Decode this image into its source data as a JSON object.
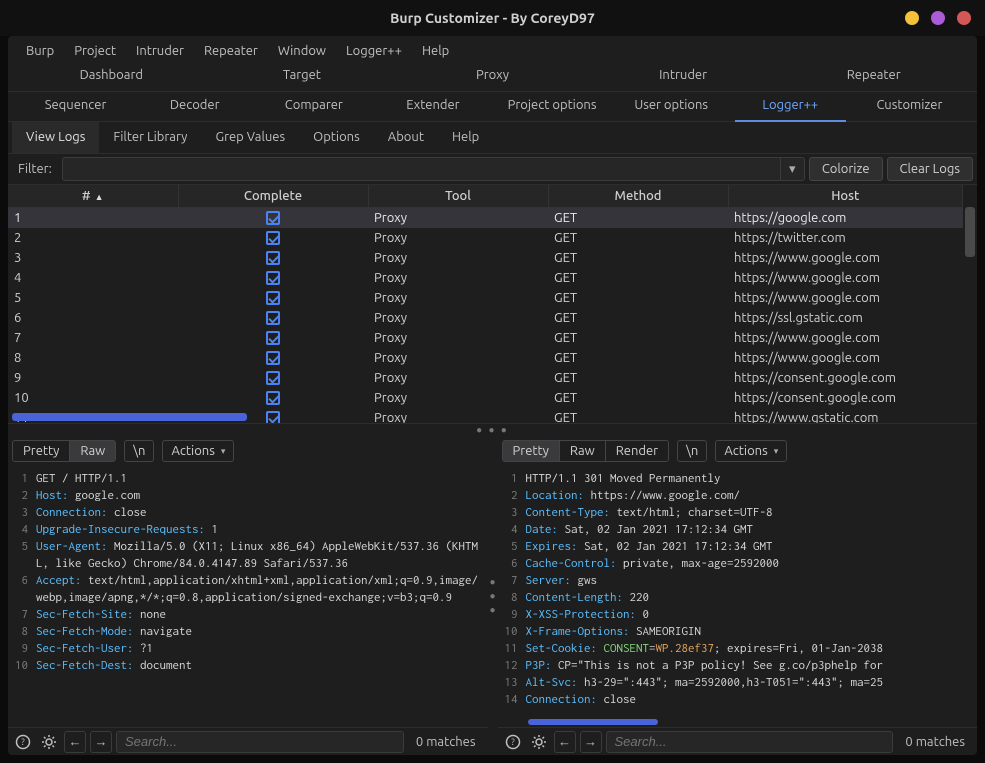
{
  "window": {
    "title": "Burp Customizer - By CoreyD97"
  },
  "menubar": [
    "Burp",
    "Project",
    "Intruder",
    "Repeater",
    "Window",
    "Logger++",
    "Help"
  ],
  "tabs_row1": [
    "Dashboard",
    "Target",
    "Proxy",
    "Intruder",
    "Repeater"
  ],
  "tabs_row2": [
    "Sequencer",
    "Decoder",
    "Comparer",
    "Extender",
    "Project options",
    "User options",
    "Logger++",
    "Customizer"
  ],
  "tabs_row2_active_index": 6,
  "subtabs": [
    "View Logs",
    "Filter Library",
    "Grep Values",
    "Options",
    "About",
    "Help"
  ],
  "subtabs_selected_index": 0,
  "filter": {
    "label": "Filter:",
    "value": "",
    "colorize_label": "Colorize",
    "clear_label": "Clear Logs"
  },
  "table": {
    "columns": [
      "#",
      "Complete",
      "Tool",
      "Method",
      "Host"
    ],
    "sort_indicator": "▲",
    "rows": [
      {
        "num": "1",
        "complete": true,
        "tool": "Proxy",
        "method": "GET",
        "host": "https://google.com",
        "selected": true
      },
      {
        "num": "2",
        "complete": true,
        "tool": "Proxy",
        "method": "GET",
        "host": "https://twitter.com"
      },
      {
        "num": "3",
        "complete": true,
        "tool": "Proxy",
        "method": "GET",
        "host": "https://www.google.com"
      },
      {
        "num": "4",
        "complete": true,
        "tool": "Proxy",
        "method": "GET",
        "host": "https://www.google.com"
      },
      {
        "num": "5",
        "complete": true,
        "tool": "Proxy",
        "method": "GET",
        "host": "https://www.google.com"
      },
      {
        "num": "6",
        "complete": true,
        "tool": "Proxy",
        "method": "GET",
        "host": "https://ssl.gstatic.com"
      },
      {
        "num": "7",
        "complete": true,
        "tool": "Proxy",
        "method": "GET",
        "host": "https://www.google.com"
      },
      {
        "num": "8",
        "complete": true,
        "tool": "Proxy",
        "method": "GET",
        "host": "https://www.google.com"
      },
      {
        "num": "9",
        "complete": true,
        "tool": "Proxy",
        "method": "GET",
        "host": "https://consent.google.com"
      },
      {
        "num": "10",
        "complete": true,
        "tool": "Proxy",
        "method": "GET",
        "host": "https://consent.google.com"
      },
      {
        "num": "11",
        "complete": true,
        "tool": "Proxy",
        "method": "GET",
        "host": "https://www.gstatic.com"
      }
    ]
  },
  "pane_toolbar": {
    "pretty": "Pretty",
    "raw": "Raw",
    "render": "Render",
    "newline": "\\n",
    "actions": "Actions"
  },
  "request_selected_seg": "Raw",
  "response_selected_seg": "Pretty",
  "request_lines": [
    {
      "n": "1",
      "html": "<span class='m'>GET / HTTP/1.1</span>"
    },
    {
      "n": "2",
      "html": "<span class='k'>Host:</span> <span class='v'>google.com</span>"
    },
    {
      "n": "3",
      "html": "<span class='k'>Connection:</span> <span class='v'>close</span>"
    },
    {
      "n": "4",
      "html": "<span class='k'>Upgrade-Insecure-Requests:</span> <span class='v'>1</span>"
    },
    {
      "n": "5",
      "html": "<span class='k'>User-Agent:</span> <span class='v'>Mozilla/5.0 (X11; Linux x86_64) AppleWebKit/537.36 (KHTML, like Gecko) Chrome/84.0.4147.89 Safari/537.36</span>"
    },
    {
      "n": "6",
      "html": "<span class='k'>Accept:</span> <span class='v'>text/html,application/xhtml+xml,application/xml;q=0.9,image/webp,image/apng,*/*;q=0.8,application/signed-exchange;v=b3;q=0.9</span>"
    },
    {
      "n": "7",
      "html": "<span class='k'>Sec-Fetch-Site:</span> <span class='v'>none</span>"
    },
    {
      "n": "8",
      "html": "<span class='k'>Sec-Fetch-Mode:</span> <span class='v'>navigate</span>"
    },
    {
      "n": "9",
      "html": "<span class='k'>Sec-Fetch-User:</span> <span class='v'>?1</span>"
    },
    {
      "n": "10",
      "html": "<span class='k'>Sec-Fetch-Dest:</span> <span class='v'>document</span>"
    }
  ],
  "response_lines": [
    {
      "n": "1",
      "html": "<span class='m'>HTTP/1.1 301 Moved Permanently</span>"
    },
    {
      "n": "2",
      "html": "<span class='k'>Location:</span> <span class='v'>https://www.google.com/</span>"
    },
    {
      "n": "3",
      "html": "<span class='k'>Content-Type:</span> <span class='v'>text/html; charset=UTF-8</span>"
    },
    {
      "n": "4",
      "html": "<span class='k'>Date:</span> <span class='v'>Sat, 02 Jan 2021 17:12:34 GMT</span>"
    },
    {
      "n": "5",
      "html": "<span class='k'>Expires:</span> <span class='v'>Sat, 02 Jan 2021 17:12:34 GMT</span>"
    },
    {
      "n": "6",
      "html": "<span class='k'>Cache-Control:</span> <span class='v'>private, max-age=2592000</span>"
    },
    {
      "n": "7",
      "html": "<span class='k'>Server:</span> <span class='v'>gws</span>"
    },
    {
      "n": "8",
      "html": "<span class='k'>Content-Length:</span> <span class='v'>220</span>"
    },
    {
      "n": "9",
      "html": "<span class='k'>X-XSS-Protection:</span> <span class='v'>0</span>"
    },
    {
      "n": "10",
      "html": "<span class='k'>X-Frame-Options:</span> <span class='v'>SAMEORIGIN</span>"
    },
    {
      "n": "11",
      "html": "<span class='k'>Set-Cookie:</span> <span class='ck'>CONSENT</span>=<span class='cv'>WP.28ef37</span><span class='v'>; expires=Fri, 01-Jan-2038</span>"
    },
    {
      "n": "12",
      "html": "<span class='k'>P3P:</span> <span class='v'>CP=\"This is not a P3P policy! See g.co/p3phelp for</span>"
    },
    {
      "n": "13",
      "html": "<span class='k'>Alt-Svc:</span> <span class='v'>h3-29=\":443\"; ma=2592000,h3-T051=\":443\"; ma=25</span>"
    },
    {
      "n": "14",
      "html": "<span class='k'>Connection:</span> <span class='v'>close</span>"
    }
  ],
  "search": {
    "placeholder": "Search...",
    "matches": "0 matches"
  }
}
